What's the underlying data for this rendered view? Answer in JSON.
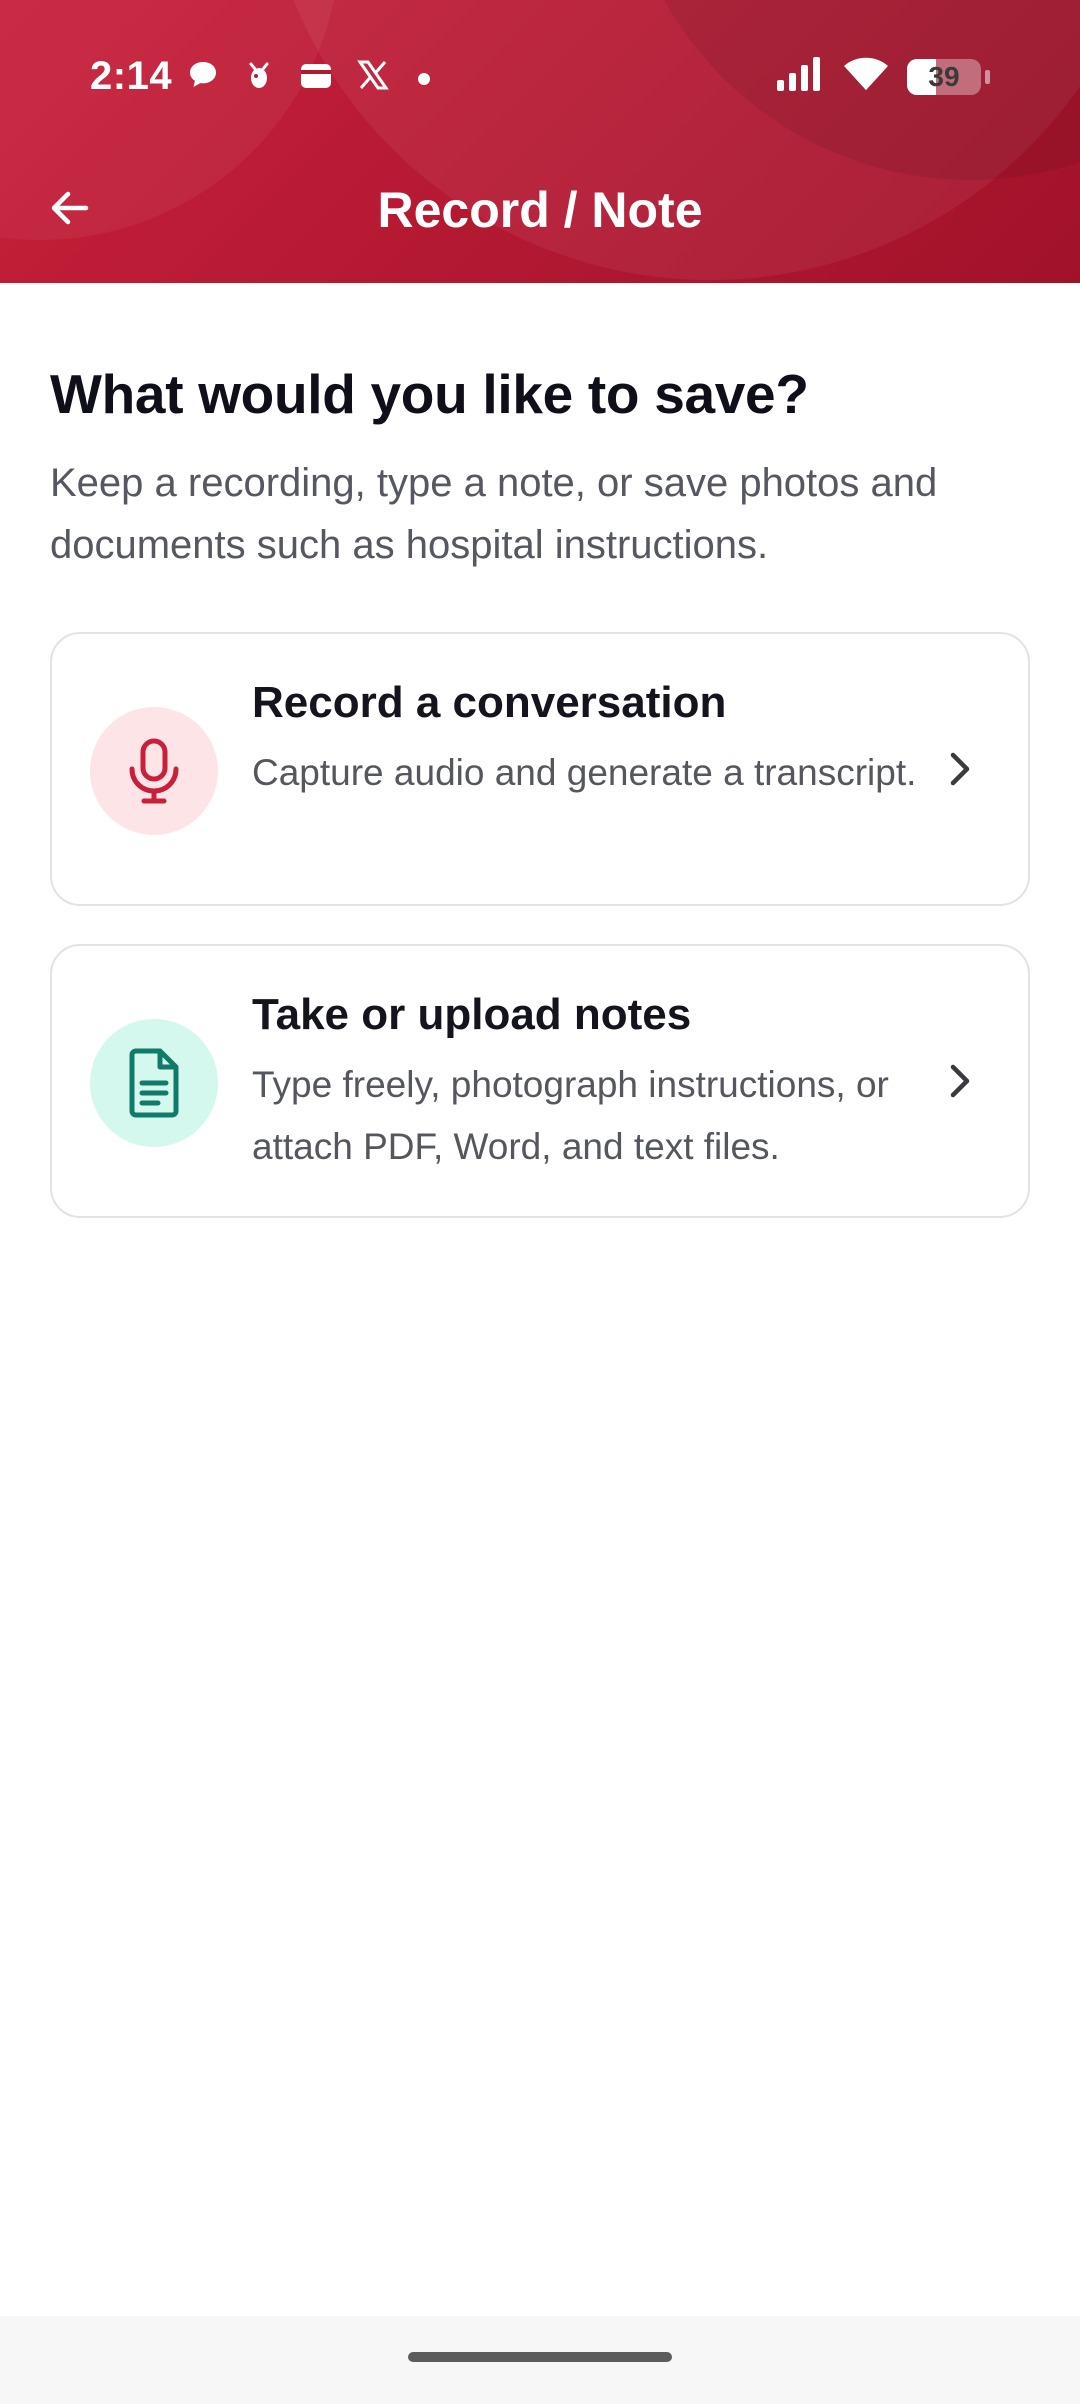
{
  "status_bar": {
    "time": "2:14",
    "battery_level": "39",
    "battery_fraction": 0.39,
    "left_icons": [
      "chat-bubble-icon",
      "bug-app-icon",
      "wallet-icon",
      "x-logo-icon",
      "notification-dot-icon"
    ],
    "right_icons": [
      "signal-icon",
      "wifi-icon",
      "battery-icon"
    ]
  },
  "header": {
    "title": "Record / Note",
    "back_icon": "arrow-left-icon",
    "color_top": "#c8203a",
    "color_bottom": "#a1122a"
  },
  "main": {
    "heading": "What would you like to save?",
    "subtitle": "Keep a recording, type a note, or save photos and documents such as hospital instructions.",
    "options": [
      {
        "title": "Record a conversation",
        "description": "Capture audio and generate a transcript.",
        "icon": "microphone-icon",
        "icon_color": "#c8203a",
        "icon_bg": "#fde4e7"
      },
      {
        "title": "Take or upload notes",
        "description": "Type freely, photograph instructions, or attach PDF, Word, and text files.",
        "icon": "document-icon",
        "icon_color": "#127a6a",
        "icon_bg": "#d4f7ee"
      }
    ]
  }
}
